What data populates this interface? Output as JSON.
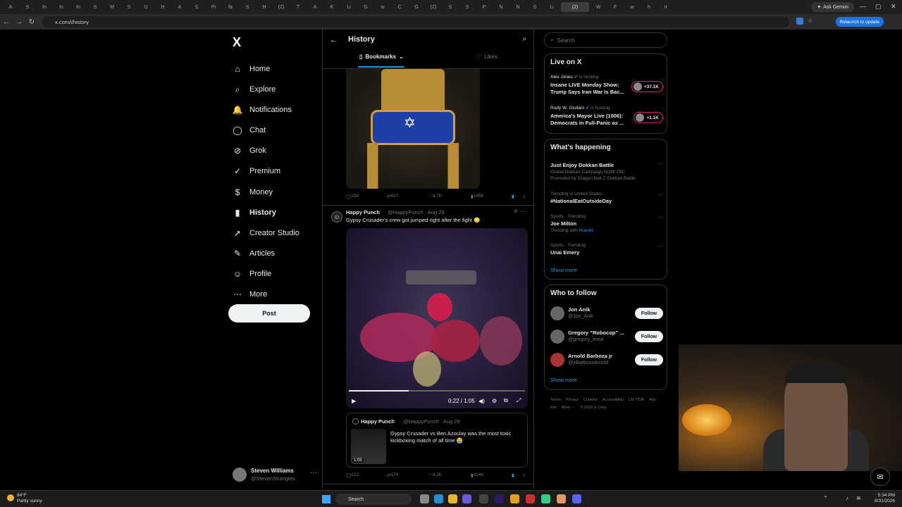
{
  "browser": {
    "tabs": [
      "A",
      "S",
      "In",
      "In",
      "In",
      "S",
      "M",
      "S",
      "U",
      "H",
      "A",
      "S",
      "Pi",
      "fa",
      "S",
      "H",
      "(2)",
      "T",
      "A",
      "K",
      "Li",
      "G",
      "w",
      "C",
      "G",
      "(2)",
      "S",
      "S",
      "P",
      "N",
      "N",
      "S",
      "Li",
      "(2)",
      "W",
      "F",
      "w",
      "h",
      "Ir"
    ],
    "active_tab": "(2)",
    "ask_gemini": "Ask Gemini",
    "url": "x.com/i/history",
    "relaunch": "Relaunch to update"
  },
  "sidebar": {
    "logo": "X",
    "items": [
      {
        "label": "Home",
        "icon": "home-icon",
        "glyph": "⌂"
      },
      {
        "label": "Explore",
        "icon": "search-icon",
        "glyph": "⌕"
      },
      {
        "label": "Notifications",
        "icon": "bell-icon",
        "glyph": "🔔"
      },
      {
        "label": "Chat",
        "icon": "chat-icon",
        "glyph": "◯"
      },
      {
        "label": "Grok",
        "icon": "grok-icon",
        "glyph": "⊘"
      },
      {
        "label": "Premium",
        "icon": "premium-icon",
        "glyph": "✓"
      },
      {
        "label": "Money",
        "icon": "money-icon",
        "glyph": "$"
      },
      {
        "label": "History",
        "icon": "bookmark-icon",
        "glyph": "▮"
      },
      {
        "label": "Creator Studio",
        "icon": "rocket-icon",
        "glyph": "➚"
      },
      {
        "label": "Articles",
        "icon": "articles-icon",
        "glyph": "✎"
      },
      {
        "label": "Profile",
        "icon": "person-icon",
        "glyph": "☺"
      },
      {
        "label": "More",
        "icon": "more-icon",
        "glyph": "⋯"
      }
    ],
    "post_label": "Post",
    "account": {
      "name": "Steven Williams",
      "handle": "@StevenStrangles"
    }
  },
  "main": {
    "title": "History",
    "tabs": [
      "Bookmarks",
      "Likes"
    ],
    "tweet1_stats": {
      "replies": "194",
      "reposts": "627",
      "likes": "8.7K",
      "views": "145K"
    },
    "tweet2": {
      "name": "Happy Punch",
      "handle": "@HappyPunch · Aug 29",
      "text": "Gypsy Crusader's crew got jumped right after the fight 😳",
      "video_time": "0:22 / 1:05",
      "video_progress": 0.34,
      "quote": {
        "name": "Happy Punch",
        "handle": "@HappyPunch · Aug 29",
        "text": "Gypsy Crusader vs Ben Azoulay was the most toxic kickboxing match of all time 😭",
        "duration": "1:05"
      },
      "stats": {
        "replies": "212",
        "reposts": "179",
        "likes": "4.2K",
        "views": "414K"
      }
    }
  },
  "right": {
    "search_placeholder": "Search",
    "live": {
      "title": "Live on X",
      "items": [
        {
          "host": "Alex Jones",
          "is": "is hosting",
          "title": "Insane LIVE Monday Show: Trump Says Iran War Is Bac...",
          "count": "+37.1K"
        },
        {
          "host": "Rudy W. Giuliani",
          "is": "is hosting",
          "title": "America's Mayor Live (1006): Democrats in Full-Panic as ...",
          "count": "+1.1K"
        }
      ]
    },
    "happening": {
      "title": "What’s happening",
      "items": [
        {
          "ctx": "",
          "title": "Just Enjoy Dokkan Battle",
          "sub": "Global Dokkan Campaign NOW ON!",
          "sub2": "Promoted by Dragon Ball Z Dokkan Battle"
        },
        {
          "ctx": "Trending in United States",
          "title": "#NationalEatOutsideDay",
          "sub": "",
          "sub2": ""
        },
        {
          "ctx": "Sports · Trending",
          "title": "Joe Milton",
          "sub": "Trending with",
          "link": "Howell"
        },
        {
          "ctx": "Sports · Trending",
          "title": "Unai Emery",
          "sub": "",
          "sub2": ""
        }
      ],
      "show_more": "Show more"
    },
    "follow": {
      "title": "Who to follow",
      "items": [
        {
          "name": "Jon Anik",
          "handle": "@Jon_Anik",
          "btn": "Follow"
        },
        {
          "name": "Gregory “Robocop” ...",
          "handle": "@gregory_mma",
          "btn": "Follow"
        },
        {
          "name": "Arnold Barboza jr",
          "handle": "@jrBarbozaArnold",
          "btn": "Follow"
        }
      ],
      "show_more": "Show more"
    },
    "footer": [
      "Terms",
      "Privacy",
      "Cookies",
      "Accessibility",
      "US-TIDA",
      "Ads info",
      "More ···",
      "© 2026 X Corp."
    ]
  },
  "taskbar": {
    "weather_temp": "84°F",
    "weather_desc": "Partly sunny",
    "search": "Search",
    "time": "5:34 PM",
    "date": "8/31/2026"
  },
  "colors": {
    "accent": "#1d9bf0",
    "live": "#f91880",
    "bg": "#000000"
  }
}
